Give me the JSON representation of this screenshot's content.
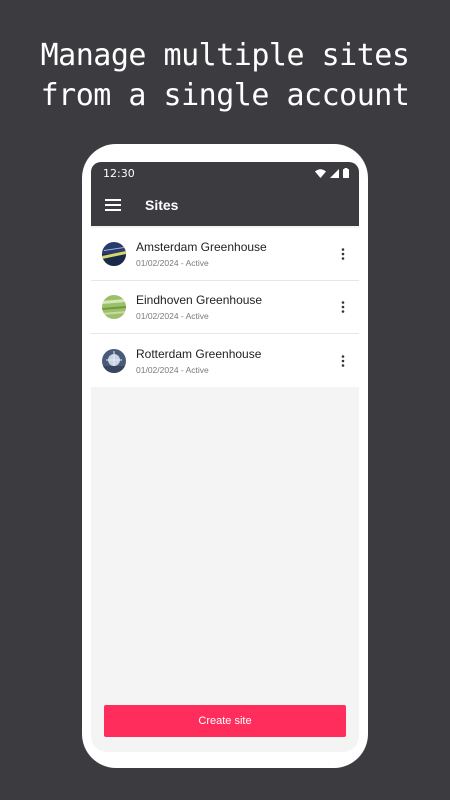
{
  "headline": {
    "line1": "Manage multiple sites",
    "line2": "from a single account"
  },
  "status_bar": {
    "time": "12:30",
    "icons": [
      "wifi-icon",
      "signal-icon",
      "battery-icon"
    ]
  },
  "app_bar": {
    "menu_icon": "hamburger-menu-icon",
    "title": "Sites"
  },
  "sites": [
    {
      "name": "Amsterdam Greenhouse",
      "subtitle": "01/02/2024 - Active",
      "thumbnail": "amsterdam-photo"
    },
    {
      "name": "Eindhoven Greenhouse",
      "subtitle": "01/02/2024 - Active",
      "thumbnail": "eindhoven-photo"
    },
    {
      "name": "Rotterdam Greenhouse",
      "subtitle": "01/02/2024 - Active",
      "thumbnail": "rotterdam-photo"
    }
  ],
  "actions": {
    "create_label": "Create site"
  },
  "colors": {
    "background": "#3c3b40",
    "accent": "#ff2d5c",
    "surface": "#ffffff",
    "screen_bg": "#f4f4f4"
  }
}
